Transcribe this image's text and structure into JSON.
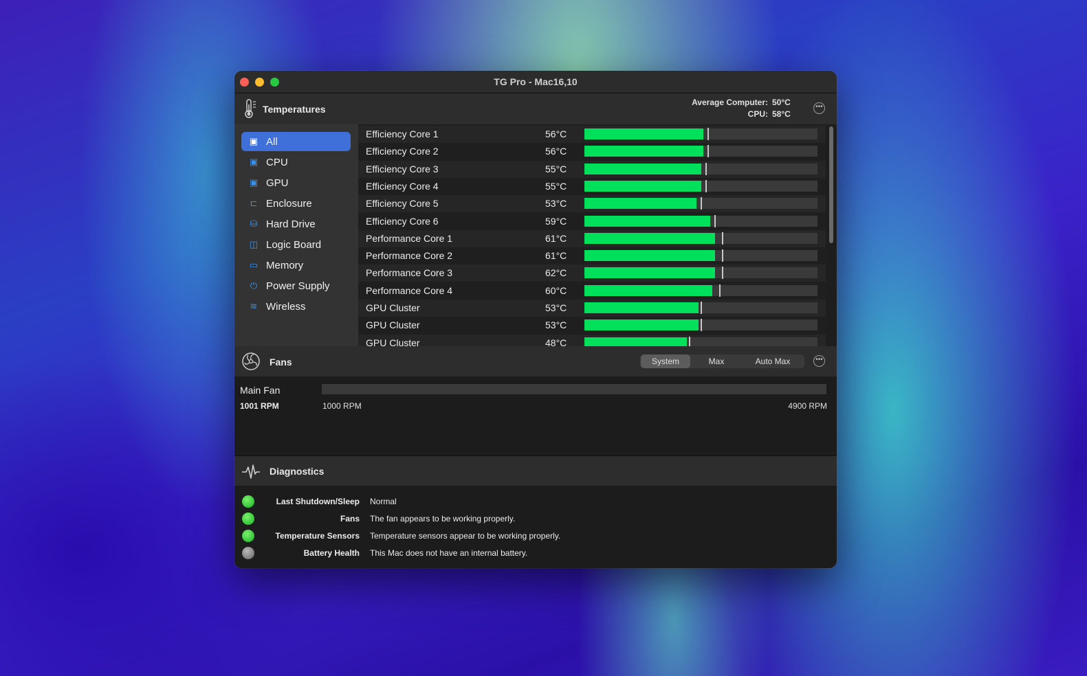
{
  "window": {
    "title": "TG Pro - Mac16,10"
  },
  "temperatures": {
    "title": "Temperatures",
    "average_label": "Average Computer:",
    "average_value": "50°C",
    "cpu_label": "CPU:",
    "cpu_value": "58°C"
  },
  "sidebar": {
    "items": [
      {
        "label": "All",
        "icon": "all-icon"
      },
      {
        "label": "CPU",
        "icon": "cpu-icon"
      },
      {
        "label": "GPU",
        "icon": "gpu-icon"
      },
      {
        "label": "Enclosure",
        "icon": "enclosure-icon"
      },
      {
        "label": "Hard Drive",
        "icon": "hard-drive-icon"
      },
      {
        "label": "Logic Board",
        "icon": "logic-board-icon"
      },
      {
        "label": "Memory",
        "icon": "memory-icon"
      },
      {
        "label": "Power Supply",
        "icon": "power-icon"
      },
      {
        "label": "Wireless",
        "icon": "wifi-icon"
      }
    ]
  },
  "sensors": [
    {
      "name": "Efficiency Core 1",
      "value": "56°C",
      "fill": 0.51,
      "max": 0.52
    },
    {
      "name": "Efficiency Core 2",
      "value": "56°C",
      "fill": 0.51,
      "max": 0.52
    },
    {
      "name": "Efficiency Core 3",
      "value": "55°C",
      "fill": 0.5,
      "max": 0.51
    },
    {
      "name": "Efficiency Core 4",
      "value": "55°C",
      "fill": 0.5,
      "max": 0.51
    },
    {
      "name": "Efficiency Core 5",
      "value": "53°C",
      "fill": 0.48,
      "max": 0.49
    },
    {
      "name": "Efficiency Core 6",
      "value": "59°C",
      "fill": 0.54,
      "max": 0.55
    },
    {
      "name": "Performance Core 1",
      "value": "61°C",
      "fill": 0.56,
      "max": 0.58
    },
    {
      "name": "Performance Core 2",
      "value": "61°C",
      "fill": 0.56,
      "max": 0.58
    },
    {
      "name": "Performance Core 3",
      "value": "62°C",
      "fill": 0.56,
      "max": 0.58
    },
    {
      "name": "Performance Core 4",
      "value": "60°C",
      "fill": 0.55,
      "max": 0.57
    },
    {
      "name": "GPU Cluster",
      "value": "53°C",
      "fill": 0.49,
      "max": 0.49
    },
    {
      "name": "GPU Cluster",
      "value": "53°C",
      "fill": 0.49,
      "max": 0.49
    },
    {
      "name": "GPU Cluster",
      "value": "48°C",
      "fill": 0.44,
      "max": 0.44
    }
  ],
  "fans": {
    "title": "Fans",
    "modes": [
      "System",
      "Max",
      "Auto Max"
    ],
    "selected_mode": "System",
    "fan_name": "Main Fan",
    "current_rpm": "1001 RPM",
    "min_rpm": "1000 RPM",
    "max_rpm": "4900 RPM"
  },
  "diagnostics": {
    "title": "Diagnostics",
    "rows": [
      {
        "label": "Last Shutdown/Sleep",
        "text": "Normal",
        "status": "ok"
      },
      {
        "label": "Fans",
        "text": "The fan appears to be working properly.",
        "status": "ok"
      },
      {
        "label": "Temperature Sensors",
        "text": "Temperature sensors appear to be working properly.",
        "status": "ok"
      },
      {
        "label": "Battery Health",
        "text": "This Mac does not have an internal battery.",
        "status": "na"
      }
    ]
  },
  "colors": {
    "accent": "#3f6fd9",
    "bar_fill": "#00e05a",
    "status_ok": "#3ccf3f",
    "status_na": "#8a8a8a"
  }
}
